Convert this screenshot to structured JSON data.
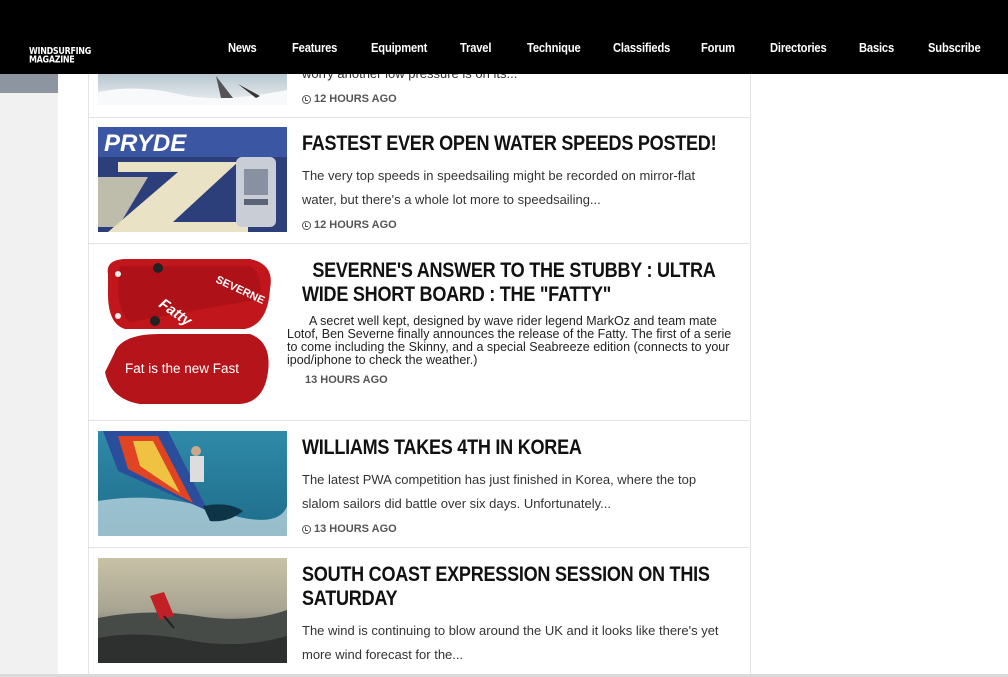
{
  "site": {
    "logo_line1": "WINDSURFING",
    "logo_line2": "MAGAZINE"
  },
  "nav": [
    "News",
    "Features",
    "Equipment",
    "Travel",
    "Technique",
    "Classifieds",
    "Forum",
    "Directories",
    "Basics",
    "Subscribe"
  ],
  "articles": [
    {
      "excerpt_partial": "worry another low pressure is on its...",
      "time": "12 HOURS AGO"
    },
    {
      "title": "FASTEST EVER OPEN WATER SPEEDS POSTED!",
      "excerpt": "The very top speeds in speedsailing might be recorded on mirror-flat water, but there's a whole lot more to speedsailing...",
      "time": "12 HOURS AGO",
      "thumb_text": "PRYDE"
    },
    {
      "title": "SEVERNE'S ANSWER TO THE STUBBY : ULTRA WIDE SHORT BOARD :  THE \"FATTY\"",
      "excerpt": "A secret well kept, designed by wave rider legend MarkOz and team mate Lotof, Ben Severne finally announces  the release of the Fatty. The first of a serie to come including the Skinny, and a special Seabreeze edition (connects to your ipod/iphone to check the weather.)",
      "time": "13 HOURS AGO",
      "thumb_brand": "SEVERNE",
      "thumb_name": "Fatty",
      "thumb_tagline": "Fat is the new Fast"
    },
    {
      "title": "WILLIAMS TAKES 4TH IN KOREA",
      "excerpt": "The latest PWA competition has just finished in Korea, where the top slalom sailors did battle over six days. Unfortunately...",
      "time": "13 HOURS AGO"
    },
    {
      "title": "SOUTH COAST EXPRESSION SESSION ON THIS SATURDAY",
      "excerpt": "The wind is continuing to blow around the UK and it looks like there's yet more wind forecast for the..."
    }
  ],
  "colors": {
    "topbar": "#000000",
    "severne_red": "#c0161c"
  }
}
